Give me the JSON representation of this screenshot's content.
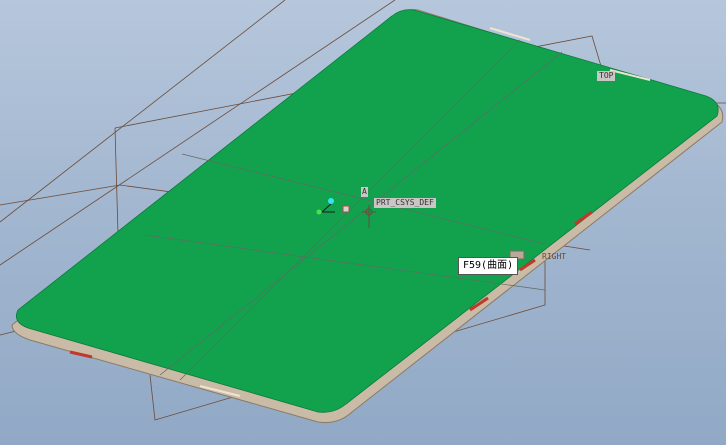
{
  "scene": {
    "background_top": "#b6c7dc",
    "background_bottom": "#91a9c6",
    "surface_color": "#12a24e",
    "rim_color": "#c9bba5",
    "datum_color": "#6b4b3a",
    "highlight_color": "#c0392b"
  },
  "datums": {
    "top": "TOP",
    "right": "RIGHT",
    "csys": "PRT_CSYS_DEF",
    "axis_marker": "A"
  },
  "tooltip": {
    "text": "F59(曲面)"
  }
}
